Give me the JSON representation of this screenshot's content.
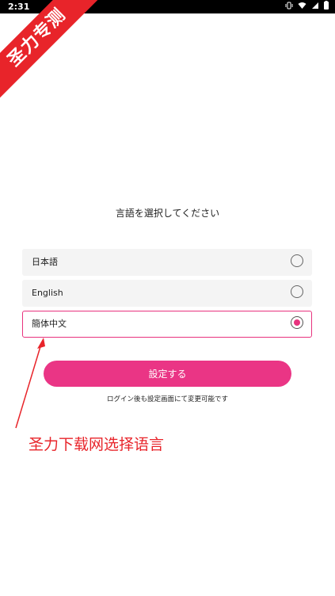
{
  "status_bar": {
    "time": "2:31",
    "icons": [
      "vibrate-icon",
      "wifi-icon",
      "signal-icon",
      "battery-icon"
    ]
  },
  "watermark": {
    "ribbon_text": "圣力专测",
    "caption": "圣力下载网选择语言"
  },
  "screen": {
    "title": "言語を選択してください",
    "languages": [
      {
        "label": "日本語",
        "selected": false
      },
      {
        "label": "English",
        "selected": false
      },
      {
        "label": "簡体中文",
        "selected": true
      }
    ],
    "submit_label": "設定する",
    "note": "ログイン後も設定画面にて変更可能です"
  },
  "colors": {
    "accent": "#ea3585",
    "watermark_red": "#e8242a",
    "option_bg": "#f4f4f4"
  }
}
